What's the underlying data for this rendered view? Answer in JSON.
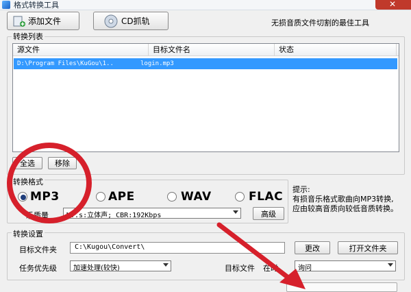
{
  "window": {
    "title": "格式转换工具",
    "close_glyph": "✕"
  },
  "toolbar": {
    "add_file_label": "添加文件",
    "cd_label": "CD抓轨",
    "slogan": "无损音质文件切割的最佳工具"
  },
  "list": {
    "group_title": "转换列表",
    "columns": [
      "源文件",
      "目标文件名",
      "状态"
    ],
    "rows": [
      {
        "source": "D:\\Program Files\\KuGou\\1..",
        "target": "login.mp3",
        "status": ""
      }
    ],
    "select_all_label": "全选",
    "remove_label": "移除"
  },
  "format": {
    "group_title": "转换格式",
    "options": [
      "MP3",
      "APE",
      "WAV",
      "FLAC"
    ],
    "selected": "MP3",
    "quality_label": "乐质量",
    "quality_value": "M..s:立体声; CBR:192Kbps",
    "advanced_label": "高级",
    "tip_title": "提示:",
    "tip_text": "有损音乐格式歌曲向MP3转换,应由较高音质向较低音质转换。"
  },
  "settings": {
    "group_title": "转换设置",
    "target_folder_label": "目标文件夹",
    "target_folder_value": "C:\\Kugou\\Convert\\",
    "change_label": "更改",
    "open_folder_label": "打开文件夹",
    "priority_label": "任务优先级",
    "priority_value": "加速处理(较快)",
    "exists_label": "目标文件",
    "exists_label_tail": "在时",
    "exists_value": "询问"
  },
  "annotations": {
    "circle_color": "#d6202b",
    "arrow_color": "#d6202b"
  }
}
